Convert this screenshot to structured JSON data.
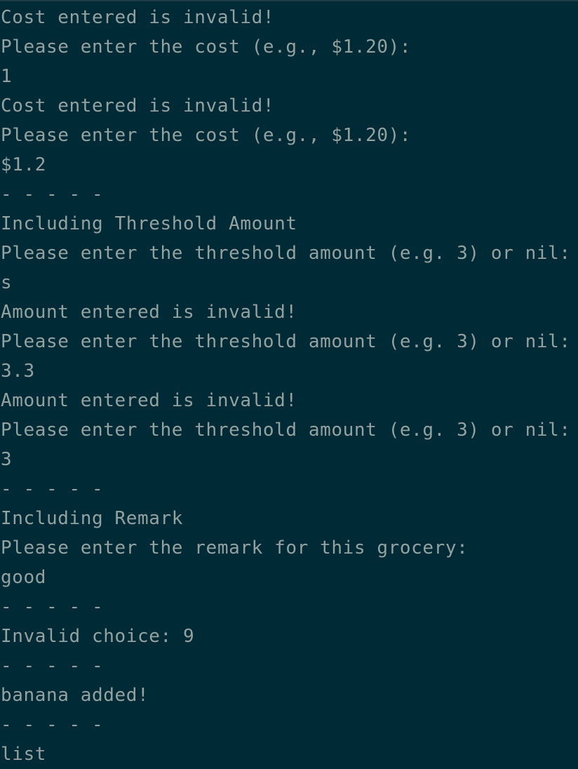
{
  "terminal": {
    "lines": [
      "Cost entered is invalid!",
      "Please enter the cost (e.g., $1.20):",
      "1",
      "Cost entered is invalid!",
      "Please enter the cost (e.g., $1.20):",
      "$1.2",
      "- - - - -",
      "Including Threshold Amount",
      "Please enter the threshold amount (e.g. 3) or nil:",
      "s",
      "Amount entered is invalid!",
      "Please enter the threshold amount (e.g. 3) or nil:",
      "3.3",
      "Amount entered is invalid!",
      "Please enter the threshold amount (e.g. 3) or nil:",
      "3",
      "- - - - -",
      "Including Remark",
      "Please enter the remark for this grocery:",
      "good",
      "- - - - -",
      "Invalid choice: 9",
      "- - - - -",
      "banana added!",
      "- - - - -",
      "list"
    ]
  }
}
